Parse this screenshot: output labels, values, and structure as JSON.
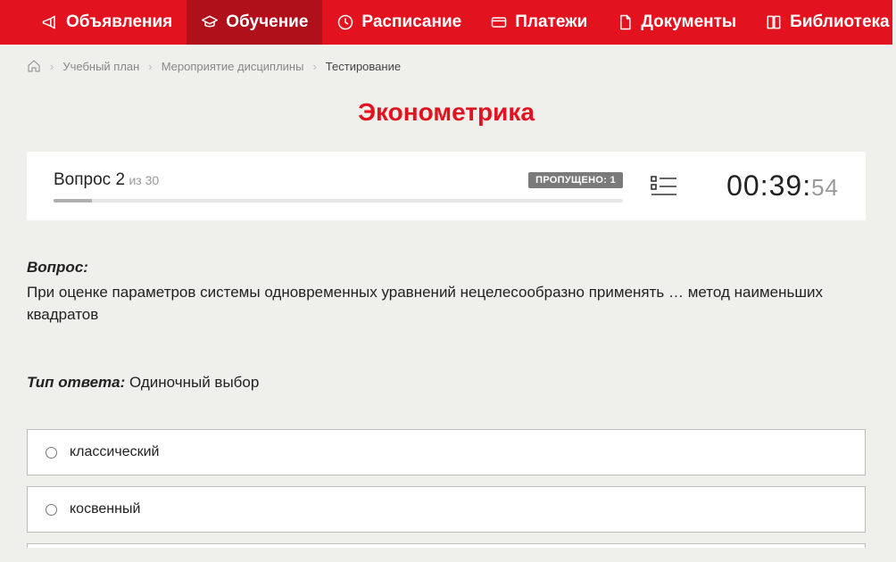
{
  "nav": {
    "items": [
      {
        "label": "Объявления",
        "icon": "megaphone",
        "active": false
      },
      {
        "label": "Обучение",
        "icon": "graduation",
        "active": true
      },
      {
        "label": "Расписание",
        "icon": "clock",
        "active": false
      },
      {
        "label": "Платежи",
        "icon": "payment",
        "active": false
      },
      {
        "label": "Документы",
        "icon": "document",
        "active": false
      },
      {
        "label": "Библиотека",
        "icon": "book",
        "active": false,
        "dropdown": true
      }
    ]
  },
  "breadcrumb": {
    "items": [
      "Учебный план",
      "Мероприятие дисциплины",
      "Тестирование"
    ]
  },
  "title": "Эконометрика",
  "status": {
    "question_label": "Вопрос 2",
    "question_total": "из 30",
    "skipped_label": "ПРОПУЩЕНО: 1",
    "timer_main": "00:39:",
    "timer_sec": "54",
    "progress_percent": 6.7
  },
  "question": {
    "label": "Вопрос:",
    "text": "При оценке параметров системы одновременных уравнений нецелесообразно применять … метод наименьших квадратов",
    "type_label": "Тип ответа:",
    "type_value": "Одиночный выбор"
  },
  "answers": [
    {
      "text": "классический"
    },
    {
      "text": "косвенный"
    }
  ]
}
